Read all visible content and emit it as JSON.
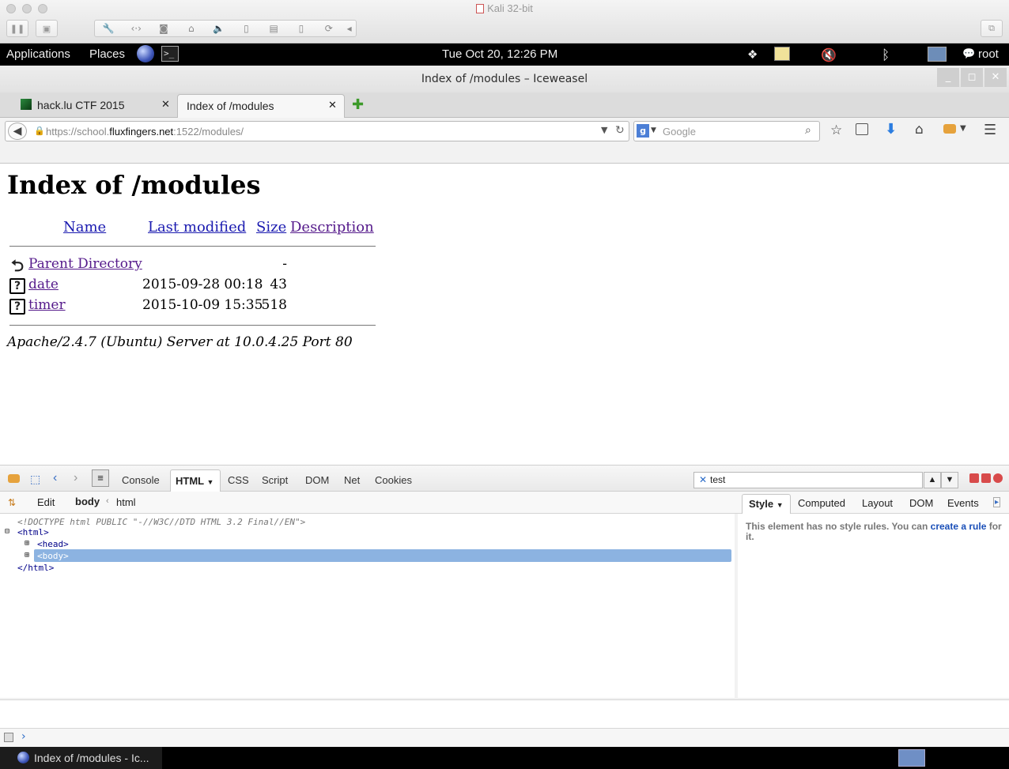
{
  "vm": {
    "title": "Kali 32-bit",
    "toolbar_icons": [
      "pause-icon",
      "snapshot-icon",
      "settings-icon",
      "code-icon",
      "disk-icon",
      "lock-icon",
      "speaker-icon",
      "mouse-icon",
      "usb-icon",
      "mouse2-icon",
      "refresh-icon",
      "arrow-icon"
    ]
  },
  "gnome_panel": {
    "applications": "Applications",
    "places": "Places",
    "clock": "Tue Oct 20, 12:26 PM",
    "user": "root"
  },
  "browser": {
    "window_title": "Index of /modules – Iceweasel",
    "tabs": [
      {
        "label": "hack.lu CTF 2015",
        "active": false
      },
      {
        "label": "Index of /modules",
        "active": true
      }
    ],
    "url": {
      "prefix": "https://school.",
      "domain": "fluxfingers.net",
      "suffix": ":1522/modules/"
    },
    "search_placeholder": "Google"
  },
  "page": {
    "heading": "Index of /modules",
    "columns": {
      "name": "Name",
      "modified": "Last modified",
      "size": "Size",
      "description": "Description"
    },
    "rows": [
      {
        "name": "Parent Directory",
        "modified": "",
        "size": "-",
        "icon": "back-icon"
      },
      {
        "name": "date",
        "modified": "2015-09-28 00:18",
        "size": "43",
        "icon": "unknown-file-icon"
      },
      {
        "name": "timer",
        "modified": "2015-10-09 15:35",
        "size": "518",
        "icon": "unknown-file-icon"
      }
    ],
    "address": "Apache/2.4.7 (Ubuntu) Server at 10.0.4.25 Port 80"
  },
  "firebug": {
    "tabs": [
      "Console",
      "HTML",
      "CSS",
      "Script",
      "DOM",
      "Net",
      "Cookies"
    ],
    "active_tab": "HTML",
    "search_value": "test",
    "edit_label": "Edit",
    "breadcrumb": [
      "body",
      "html"
    ],
    "tree": {
      "doctype": "<!DOCTYPE html PUBLIC \"-//W3C//DTD HTML 3.2 Final//EN\">",
      "html_open": "<html>",
      "head": "<head>",
      "body": "<body>",
      "html_close": "</html>"
    },
    "side_tabs": [
      "Style",
      "Computed",
      "Layout",
      "DOM",
      "Events"
    ],
    "side_message": "This element has no style rules. You can ",
    "side_link1": "create a",
    "side_link2": "rule",
    "side_message_end": " for it.",
    "accent": "#8cb3e1"
  },
  "taskbar": {
    "window_label": "Index of /modules - Ic..."
  }
}
